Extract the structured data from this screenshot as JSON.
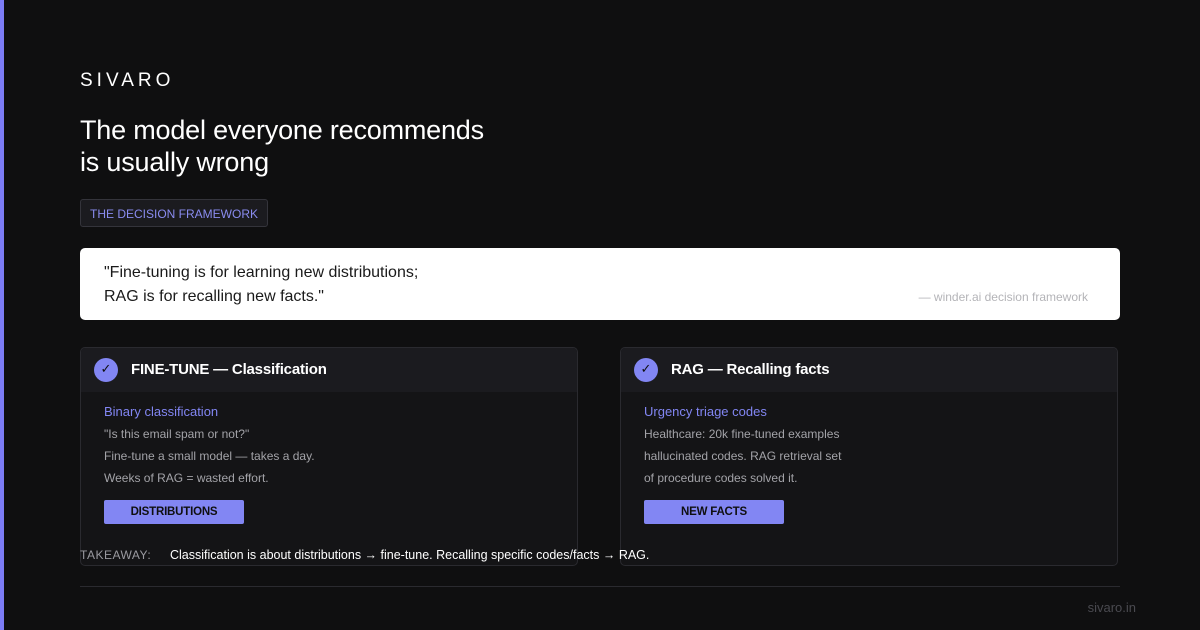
{
  "brand": "SIVARO",
  "headline": [
    "The model everyone recommends",
    "is usually wrong"
  ],
  "pill_label": "THE DECISION FRAMEWORK",
  "quote": {
    "lines": [
      "\"Fine-tuning is for learning new distributions;",
      "RAG is for recalling new facts.\""
    ],
    "source": "— winder.ai decision framework"
  },
  "cards": [
    {
      "check_icon": "✓",
      "title": "FINE-TUNE — Classification",
      "subtitle": "Binary classification",
      "lines": [
        "\"Is this email spam or not?\"",
        "Fine-tune a small model — takes a day.",
        "Weeks of RAG = wasted effort."
      ],
      "tag": "DISTRIBUTIONS"
    },
    {
      "check_icon": "✓",
      "title": "RAG — Recalling facts",
      "subtitle": "Urgency triage codes",
      "lines": [
        "Healthcare: 20k fine-tuned examples",
        "hallucinated codes. RAG retrieval set",
        "of procedure codes solved it."
      ],
      "tag": "NEW FACTS"
    }
  ],
  "takeaway": {
    "label": "TAKEAWAY:",
    "text": "Classification is about distributions → fine-tune. Recalling specific codes/facts → RAG."
  },
  "footer": "sivaro.in",
  "colors": {
    "accent": "#7c7cf5",
    "background": "#0f0f10",
    "card": "#141416"
  }
}
